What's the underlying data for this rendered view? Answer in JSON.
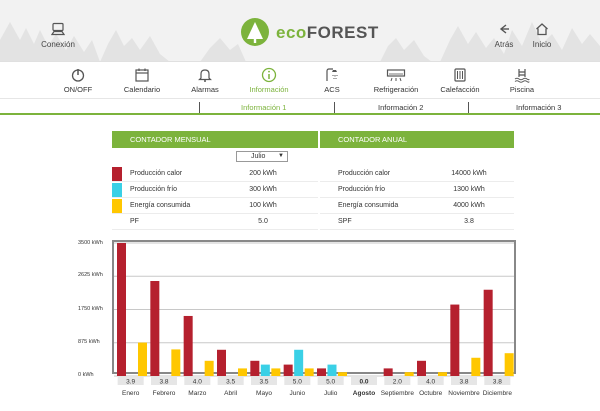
{
  "header": {
    "left_button": "Conexión",
    "back_button": "Atrás",
    "home_button": "Inicio",
    "logo": "ecoFOREST"
  },
  "nav": {
    "items": [
      {
        "label": "ON/OFF",
        "icon": "power-icon"
      },
      {
        "label": "Calendario",
        "icon": "calendar-icon"
      },
      {
        "label": "Alarmas",
        "icon": "bell-icon"
      },
      {
        "label": "Información",
        "icon": "info-icon",
        "active": true
      },
      {
        "label": "ACS",
        "icon": "shower-icon"
      },
      {
        "label": "Refrigeración",
        "icon": "air-conditioner-icon"
      },
      {
        "label": "Calefacción",
        "icon": "radiator-icon"
      },
      {
        "label": "Piscina",
        "icon": "pool-icon"
      }
    ],
    "subtabs": [
      "Información 1",
      "Información 2",
      "Información 3"
    ]
  },
  "monthly": {
    "title": "CONTADOR MENSUAL",
    "selected_month": "Julio",
    "rows": [
      {
        "label": "Producción calor",
        "value": "200 kWh",
        "color": "#b5202e"
      },
      {
        "label": "Producción frío",
        "value": "300 kWh",
        "color": "#3ad0e6"
      },
      {
        "label": "Energía consumida",
        "value": "100 kWh",
        "color": "#ffc700"
      },
      {
        "label": "PF",
        "value": "5.0",
        "color": ""
      }
    ]
  },
  "annual": {
    "title": "CONTADOR ANUAL",
    "rows": [
      {
        "label": "Producción calor",
        "value": "14000 kWh"
      },
      {
        "label": "Producción frío",
        "value": "1300 kWh"
      },
      {
        "label": "Energía consumida",
        "value": "4000 kWh"
      },
      {
        "label": "SPF",
        "value": "3.8"
      }
    ]
  },
  "colors": {
    "accent": "#7cb33c",
    "heat": "#b5202e",
    "cool": "#3ad0e6",
    "energy": "#ffc700"
  },
  "chart_data": {
    "type": "bar",
    "yticks": [
      "3500 kWh",
      "2625 kWh",
      "1750 kWh",
      "875 kWh",
      "0 kWh"
    ],
    "ylim": [
      0,
      3500
    ],
    "categories": [
      "Enero",
      "Febrero",
      "Marzo",
      "Abril",
      "Mayo",
      "Junio",
      "Julio",
      "Agosto",
      "Septiembre",
      "Octubre",
      "Noviembre",
      "Diciembre"
    ],
    "selected_category": "Agosto",
    "pf": [
      "3.9",
      "3.8",
      "4.0",
      "3.5",
      "3.5",
      "5.0",
      "5.0",
      "0.0",
      "2.0",
      "4.0",
      "3.8",
      "3.8"
    ],
    "series": [
      {
        "name": "Producción calor",
        "values": [
          3500,
          2500,
          1580,
          690,
          400,
          300,
          200,
          0,
          200,
          400,
          1880,
          2270
        ]
      },
      {
        "name": "Producción frío",
        "values": [
          0,
          0,
          0,
          0,
          300,
          690,
          300,
          0,
          0,
          0,
          0,
          0
        ]
      },
      {
        "name": "Energía consumida",
        "values": [
          880,
          700,
          400,
          200,
          200,
          200,
          100,
          0,
          100,
          100,
          480,
          600
        ]
      }
    ]
  }
}
